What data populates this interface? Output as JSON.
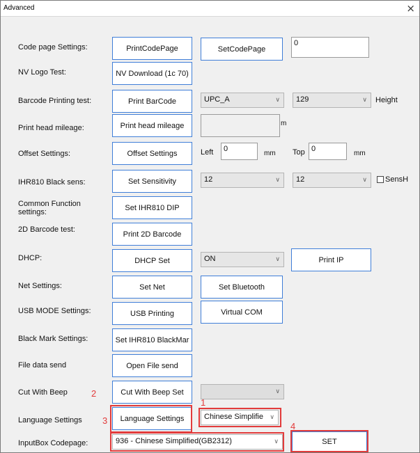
{
  "window": {
    "title": "Advanced",
    "close_glyph": "×"
  },
  "rows": {
    "code_page": {
      "label": "Code page Settings:",
      "btn1": "PrintCodePage",
      "btn2": "SetCodePage",
      "value": "0"
    },
    "nv_logo": {
      "label": "NV Logo Test:",
      "btn": "NV Download (1c 70)"
    },
    "barcode": {
      "label": "Barcode Printing test:",
      "btn": "Print BarCode",
      "type": "UPC_A",
      "height_value": "129",
      "height_label": "Height"
    },
    "mileage": {
      "label": "Print head mileage:",
      "btn": "Print head mileage",
      "value": "",
      "unit": "m"
    },
    "offset": {
      "label": "Offset Settings:",
      "btn": "Offset Settings",
      "left_label": "Left",
      "left_value": "0",
      "left_unit": "mm",
      "top_label": "Top",
      "top_value": "0",
      "top_unit": "mm"
    },
    "black_sens": {
      "label": "IHR810 Black sens:",
      "btn": "Set Sensitivity",
      "sel1": "12",
      "sel2": "12",
      "check_label": "SensH",
      "checked": false
    },
    "common": {
      "label": "Common Function settings:",
      "btn": "Set IHR810 DIP"
    },
    "barcode2d": {
      "label": "2D Barcode test:",
      "btn": "Print 2D Barcode"
    },
    "dhcp": {
      "label": "DHCP:",
      "btn": "DHCP Set",
      "value": "ON",
      "btn2": "Print IP"
    },
    "net": {
      "label": "Net Settings:",
      "btn1": "Set Net",
      "btn2": "Set Bluetooth"
    },
    "usb": {
      "label": "USB MODE Settings:",
      "btn1": "USB Printing",
      "btn2": "Virtual COM"
    },
    "black_mark": {
      "label": "Black Mark Settings:",
      "btn": "Set IHR810 BlackMar"
    },
    "file_send": {
      "label": "File data send",
      "btn": "Open File send"
    },
    "cut_beep": {
      "label": "Cut With Beep",
      "btn": "Cut With Beep Set",
      "value": ""
    },
    "language": {
      "label": "Language Settings",
      "btn": "Language Settings",
      "value": "Chinese Simplifie"
    },
    "inputbox": {
      "label": "InputBox Codepage:",
      "value": "936 - Chinese Simplified(GB2312)",
      "btn": "SET"
    }
  },
  "annotations": {
    "n1": "1",
    "n2": "2",
    "n3": "3",
    "n4": "4",
    "color": "#e23b3b"
  },
  "icons": {
    "dropdown": "chevron-down-icon"
  }
}
